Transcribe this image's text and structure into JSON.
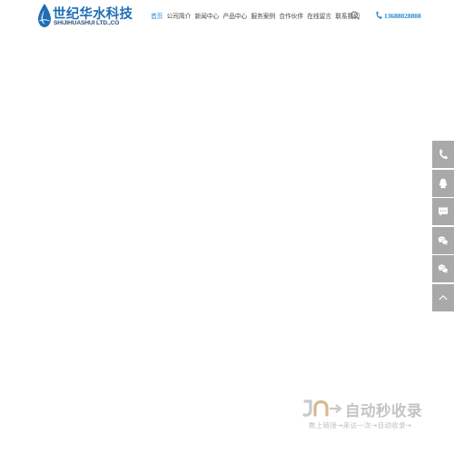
{
  "logo": {
    "title": "世纪华水科技",
    "subtitle": "SHIJIHUASHUI LTD.,CO"
  },
  "nav": {
    "items": [
      {
        "label": "首页",
        "active": true
      },
      {
        "label": "公司简介",
        "active": false
      },
      {
        "label": "新闻中心",
        "active": false
      },
      {
        "label": "产品中心",
        "active": false
      },
      {
        "label": "服务案例",
        "active": false
      },
      {
        "label": "合作伙伴",
        "active": false
      },
      {
        "label": "在线留言",
        "active": false
      },
      {
        "label": "联系我们",
        "active": false
      }
    ]
  },
  "search": {
    "icon": "search-icon"
  },
  "phone": {
    "icon": "phone-icon",
    "number": "13688028808"
  },
  "sidebar": {
    "items": [
      {
        "icon": "phone-icon"
      },
      {
        "icon": "qq-icon"
      },
      {
        "icon": "message-icon"
      },
      {
        "icon": "wechat-icon"
      },
      {
        "icon": "wechat-icon"
      },
      {
        "icon": "chevron-up-icon"
      }
    ]
  },
  "watermark": {
    "title": "自动秒收录",
    "subtitle": "数上链接→来访一次→自动收录→"
  },
  "colors": {
    "brand": "#1f6db5",
    "accent": "#1e88d8",
    "sidebar": "#a9a9a9",
    "watermark": "#c4c4c4"
  }
}
